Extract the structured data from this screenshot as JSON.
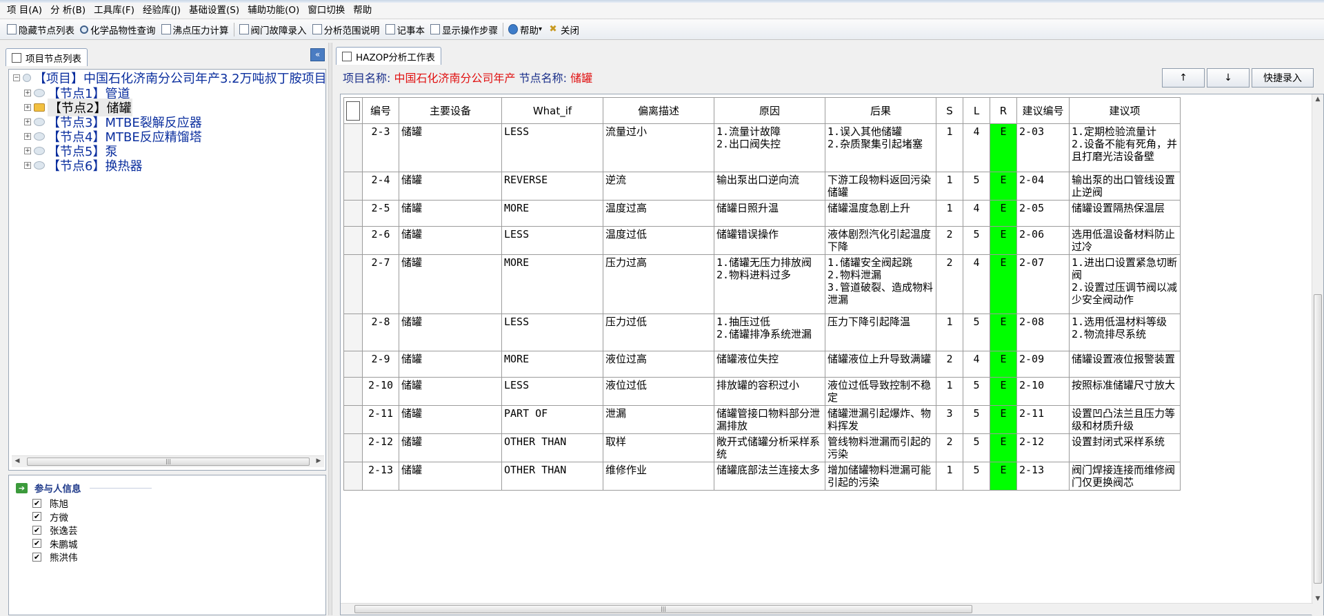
{
  "menubar": {
    "items": [
      "项 目(A)",
      "分 析(B)",
      "工具库(F)",
      "经验库(J)",
      "基础设置(S)",
      "辅助功能(O)",
      "窗口切换",
      "帮助"
    ]
  },
  "toolbar": {
    "items": [
      {
        "label": "隐藏节点列表",
        "icon": "list-icon"
      },
      {
        "label": "化学品物性查询",
        "icon": "search-icon"
      },
      {
        "label": "沸点压力计算",
        "icon": "document-icon"
      },
      {
        "label": "阀门故障录入",
        "icon": "valve-icon"
      },
      {
        "label": "分析范围说明",
        "icon": "edit-icon"
      },
      {
        "label": "记事本",
        "icon": "notepad-icon"
      },
      {
        "label": "显示操作步骤",
        "icon": "steps-icon"
      },
      {
        "label": "帮助",
        "icon": "help-icon"
      },
      {
        "label": "关闭",
        "icon": "close-icon"
      }
    ]
  },
  "left_panel": {
    "tab_label": "项目节点列表",
    "collapse_glyph": "«",
    "tree": {
      "root": "【项目】中国石化济南分公司年产3.2万吨叔丁胺项目",
      "nodes": [
        {
          "label": "【节点1】管道",
          "selected": false
        },
        {
          "label": "【节点2】储罐",
          "selected": true
        },
        {
          "label": "【节点3】MTBE裂解反应器",
          "selected": false
        },
        {
          "label": "【节点4】MTBE反应精馏塔",
          "selected": false
        },
        {
          "label": "【节点5】泵",
          "selected": false
        },
        {
          "label": "【节点6】换热器",
          "selected": false
        }
      ]
    },
    "participants": {
      "title": "参与人信息",
      "people": [
        "陈旭",
        "方微",
        "张逸芸",
        "朱鹏城",
        "熊洪伟"
      ]
    }
  },
  "right_panel": {
    "tab_label": "HAZOP分析工作表",
    "project_label": "项目名称:",
    "project_value": "中国石化济南分公司年产",
    "node_label": "节点名称:",
    "node_value": "储罐",
    "buttons": {
      "up": "↑",
      "down": "↓",
      "quick_entry": "快捷录入"
    },
    "table": {
      "headers": [
        "编号",
        "主要设备",
        "What_if",
        "偏离描述",
        "原因",
        "后果",
        "S",
        "L",
        "R",
        "建议编号",
        "建议项"
      ],
      "rows": [
        {
          "id": "2-3",
          "equip": "储罐",
          "whatif": "LESS",
          "dev": "流量过小",
          "cause": "1.流量计故障\n2.出口阀失控",
          "conseq": "1.误入其他储罐\n2.杂质聚集引起堵塞",
          "s": "1",
          "l": "4",
          "r": "E",
          "sid": "2-03",
          "sug": "1.定期检验流量计\n2.设备不能有死角，并且打磨光洁设备壁"
        },
        {
          "id": "2-4",
          "equip": "储罐",
          "whatif": "REVERSE",
          "dev": "逆流",
          "cause": "输出泵出口逆向流",
          "conseq": "下游工段物料返回污染储罐",
          "s": "1",
          "l": "5",
          "r": "E",
          "sid": "2-04",
          "sug": "输出泵的出口管线设置止逆阀"
        },
        {
          "id": "2-5",
          "equip": "储罐",
          "whatif": "MORE",
          "dev": "温度过高",
          "cause": "储罐日照升温",
          "conseq": "储罐温度急剧上升",
          "s": "1",
          "l": "4",
          "r": "E",
          "sid": "2-05",
          "sug": "储罐设置隔热保温层"
        },
        {
          "id": "2-6",
          "equip": "储罐",
          "whatif": "LESS",
          "dev": "温度过低",
          "cause": "储罐错误操作",
          "conseq": "液体剧烈汽化引起温度下降",
          "s": "2",
          "l": "5",
          "r": "E",
          "sid": "2-06",
          "sug": "选用低温设备材料防止过冷"
        },
        {
          "id": "2-7",
          "equip": "储罐",
          "whatif": "MORE",
          "dev": "压力过高",
          "cause": "1.储罐无压力排放阀\n2.物料进料过多",
          "conseq": "1.储罐安全阀起跳\n2.物料泄漏\n3.管道破裂、造成物料泄漏",
          "s": "2",
          "l": "4",
          "r": "E",
          "sid": "2-07",
          "sug": "1.进出口设置紧急切断阀\n2.设置过压调节阀以减少安全阀动作"
        },
        {
          "id": "2-8",
          "equip": "储罐",
          "whatif": "LESS",
          "dev": "压力过低",
          "cause": "1.抽压过低\n2.储罐排净系统泄漏",
          "conseq": "压力下降引起降温",
          "s": "1",
          "l": "5",
          "r": "E",
          "sid": "2-08",
          "sug": "1.选用低温材料等级\n2.物流排尽系统"
        },
        {
          "id": "2-9",
          "equip": "储罐",
          "whatif": "MORE",
          "dev": "液位过高",
          "cause": "储罐液位失控",
          "conseq": "储罐液位上升导致满罐",
          "s": "2",
          "l": "4",
          "r": "E",
          "sid": "2-09",
          "sug": "储罐设置液位报警装置"
        },
        {
          "id": "2-10",
          "equip": "储罐",
          "whatif": "LESS",
          "dev": "液位过低",
          "cause": "排放罐的容积过小",
          "conseq": "液位过低导致控制不稳定",
          "s": "1",
          "l": "5",
          "r": "E",
          "sid": "2-10",
          "sug": "按照标准储罐尺寸放大"
        },
        {
          "id": "2-11",
          "equip": "储罐",
          "whatif": "PART OF",
          "dev": "泄漏",
          "cause": "储罐管接口物料部分泄漏排放",
          "conseq": "储罐泄漏引起爆炸、物料挥发",
          "s": "3",
          "l": "5",
          "r": "E",
          "sid": "2-11",
          "sug": "设置凹凸法兰且压力等级和材质升级"
        },
        {
          "id": "2-12",
          "equip": "储罐",
          "whatif": "OTHER THAN",
          "dev": "取样",
          "cause": "敞开式储罐分析采样系统",
          "conseq": "管线物料泄漏而引起的污染",
          "s": "2",
          "l": "5",
          "r": "E",
          "sid": "2-12",
          "sug": "设置封闭式采样系统"
        },
        {
          "id": "2-13",
          "equip": "储罐",
          "whatif": "OTHER THAN",
          "dev": "维修作业",
          "cause": "储罐底部法兰连接太多",
          "conseq": "增加储罐物料泄漏可能引起的污染",
          "s": "1",
          "l": "5",
          "r": "E",
          "sid": "2-13",
          "sug": "阀门焊接连接而维修阀门仅更换阀芯"
        }
      ]
    }
  },
  "colors": {
    "risk_e": "#00ff00",
    "project_value": "#e01010",
    "link_blue": "#0a2e9e"
  }
}
